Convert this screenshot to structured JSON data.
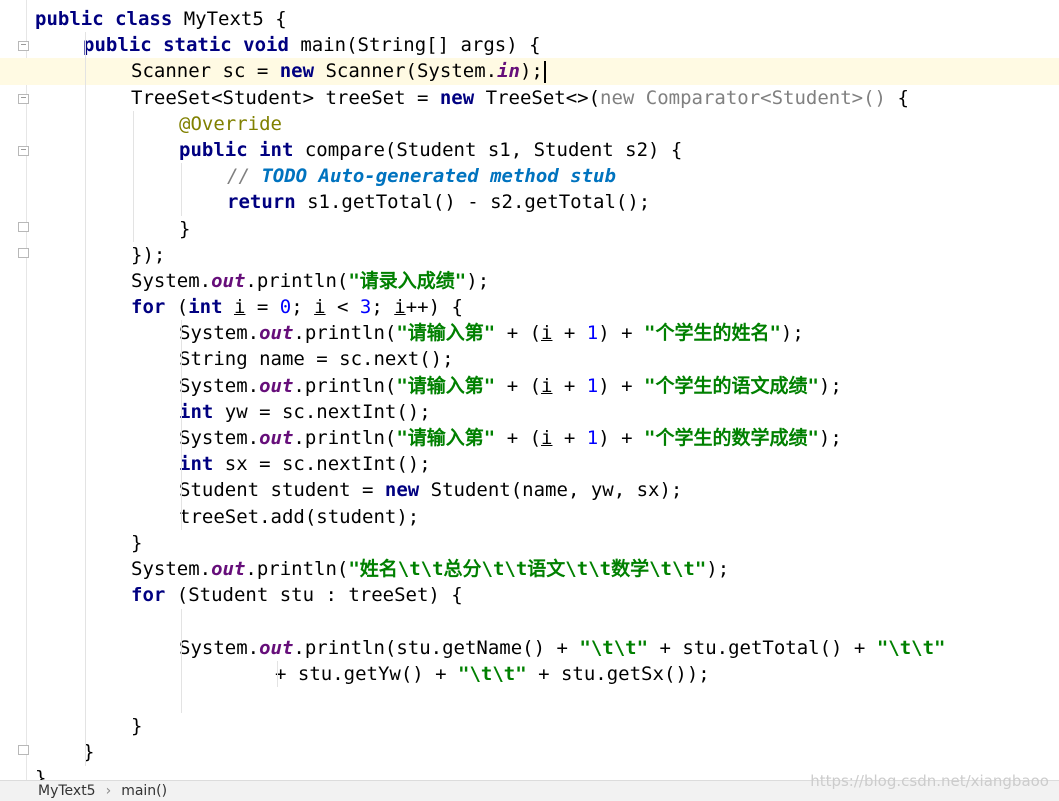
{
  "editor": {
    "lines": [
      {
        "t": [
          [
            "kw",
            "public class "
          ],
          [
            "",
            "MyText5 {"
          ]
        ]
      },
      {
        "t": [
          [
            "kw",
            "public static void "
          ],
          [
            "",
            "main(String[] args) {"
          ]
        ]
      },
      {
        "t": [
          [
            "",
            "Scanner sc = "
          ],
          [
            "kw",
            "new "
          ],
          [
            "",
            "Scanner(System."
          ],
          [
            "fld",
            "in"
          ],
          [
            "",
            ");"
          ]
        ]
      },
      {
        "t": [
          [
            "",
            "TreeSet<Student> treeSet = "
          ],
          [
            "kw",
            "new "
          ],
          [
            "",
            "TreeSet<>("
          ],
          [
            "gray",
            "new Comparator<Student>() "
          ],
          [
            "",
            "{"
          ]
        ]
      },
      {
        "t": [
          [
            "ann",
            "@Override"
          ]
        ]
      },
      {
        "t": [
          [
            "kw",
            "public int "
          ],
          [
            "",
            "compare(Student s1, Student s2) {"
          ]
        ]
      },
      {
        "t": [
          [
            "cmt",
            "// "
          ],
          [
            "todo",
            "TODO Auto-generated method stub"
          ]
        ]
      },
      {
        "t": [
          [
            "kw",
            "return "
          ],
          [
            "",
            "s1.getTotal() - s2.getTotal();"
          ]
        ]
      },
      {
        "t": [
          [
            "",
            "}"
          ]
        ]
      },
      {
        "t": [
          [
            "",
            "});"
          ]
        ]
      },
      {
        "t": [
          [
            "",
            "System."
          ],
          [
            "fld",
            "out"
          ],
          [
            "",
            ".println("
          ],
          [
            "str",
            "\"请录入成绩\""
          ],
          [
            "",
            ");"
          ]
        ]
      },
      {
        "t": [
          [
            "kw",
            "for "
          ],
          [
            "",
            "("
          ],
          [
            "kw",
            "int "
          ],
          [
            "ul",
            "i"
          ],
          [
            "",
            " = "
          ],
          [
            "num",
            "0"
          ],
          [
            "",
            "; "
          ],
          [
            "ul",
            "i"
          ],
          [
            "",
            " < "
          ],
          [
            "num",
            "3"
          ],
          [
            "",
            "; "
          ],
          [
            "ul",
            "i"
          ],
          [
            "",
            "++) {"
          ]
        ]
      },
      {
        "t": [
          [
            "",
            "System."
          ],
          [
            "fld",
            "out"
          ],
          [
            "",
            ".println("
          ],
          [
            "str",
            "\"请输入第\""
          ],
          [
            "",
            " + ("
          ],
          [
            "ul",
            "i"
          ],
          [
            "",
            " + "
          ],
          [
            "num",
            "1"
          ],
          [
            "",
            ") + "
          ],
          [
            "str",
            "\"个学生的姓名\""
          ],
          [
            "",
            ");"
          ]
        ]
      },
      {
        "t": [
          [
            "",
            "String name = sc.next();"
          ]
        ]
      },
      {
        "t": [
          [
            "",
            "System."
          ],
          [
            "fld",
            "out"
          ],
          [
            "",
            ".println("
          ],
          [
            "str",
            "\"请输入第\""
          ],
          [
            "",
            " + ("
          ],
          [
            "ul",
            "i"
          ],
          [
            "",
            " + "
          ],
          [
            "num",
            "1"
          ],
          [
            "",
            ") + "
          ],
          [
            "str",
            "\"个学生的语文成绩\""
          ],
          [
            "",
            ");"
          ]
        ]
      },
      {
        "t": [
          [
            "kw",
            "int "
          ],
          [
            "",
            "yw = sc.nextInt();"
          ]
        ]
      },
      {
        "t": [
          [
            "",
            "System."
          ],
          [
            "fld",
            "out"
          ],
          [
            "",
            ".println("
          ],
          [
            "str",
            "\"请输入第\""
          ],
          [
            "",
            " + ("
          ],
          [
            "ul",
            "i"
          ],
          [
            "",
            " + "
          ],
          [
            "num",
            "1"
          ],
          [
            "",
            ") + "
          ],
          [
            "str",
            "\"个学生的数学成绩\""
          ],
          [
            "",
            ");"
          ]
        ]
      },
      {
        "t": [
          [
            "kw",
            "int "
          ],
          [
            "",
            "sx = sc.nextInt();"
          ]
        ]
      },
      {
        "t": [
          [
            "",
            "Student student = "
          ],
          [
            "kw",
            "new "
          ],
          [
            "",
            "Student(name, yw, sx);"
          ]
        ]
      },
      {
        "t": [
          [
            "",
            "treeSet.add(student);"
          ]
        ]
      },
      {
        "t": [
          [
            "",
            "}"
          ]
        ]
      },
      {
        "t": [
          [
            "",
            "System."
          ],
          [
            "fld",
            "out"
          ],
          [
            "",
            ".println("
          ],
          [
            "str",
            "\"姓名\\t\\t总分\\t\\t语文\\t\\t数学\\t\\t\""
          ],
          [
            "",
            ");"
          ]
        ]
      },
      {
        "t": [
          [
            "kw",
            "for "
          ],
          [
            "",
            "(Student stu : treeSet) {"
          ]
        ]
      },
      {
        "t": []
      },
      {
        "t": [
          [
            "",
            "System."
          ],
          [
            "fld",
            "out"
          ],
          [
            "",
            ".println(stu.getName() + "
          ],
          [
            "str",
            "\"\\t\\t\""
          ],
          [
            "",
            " + stu.getTotal() + "
          ],
          [
            "str",
            "\"\\t\\t\""
          ]
        ]
      },
      {
        "t": [
          [
            "",
            "+ stu.getYw() + "
          ],
          [
            "str",
            "\"\\t\\t\""
          ],
          [
            "",
            " + stu.getSx());"
          ]
        ]
      },
      {
        "t": []
      },
      {
        "t": [
          [
            "",
            "}"
          ]
        ]
      },
      {
        "t": [
          [
            "",
            "}"
          ]
        ]
      },
      {
        "t": [
          [
            "",
            "}"
          ]
        ]
      }
    ]
  },
  "breadcrumb": {
    "file": "MyText5",
    "method": "main()"
  },
  "watermark": "https://blog.csdn.net/xiangbaoo"
}
